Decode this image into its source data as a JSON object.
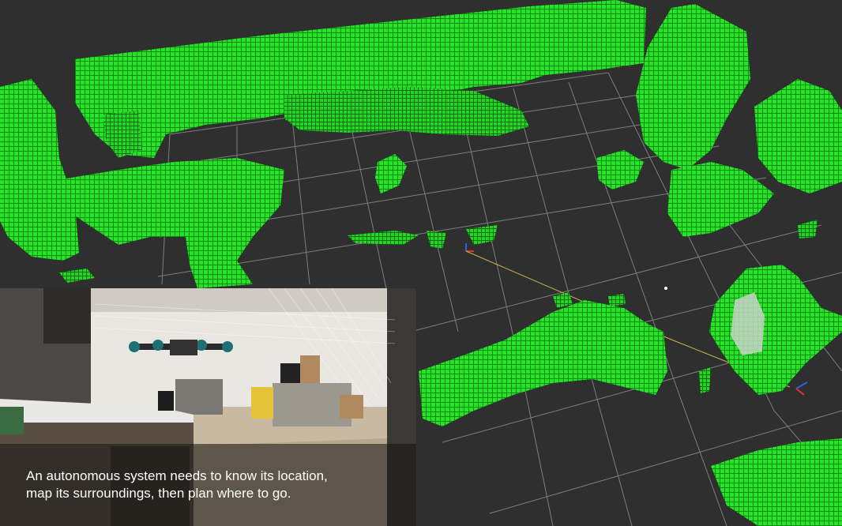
{
  "scene": {
    "background_color": "#2f2f30",
    "grid_color": "#8a8a8a",
    "voxel_color": "#22dd22",
    "voxel_shadow_color": "#0f7a0f"
  },
  "inset_video": {
    "caption_lines": [
      "An autonomous system needs to know its location,",
      "map its surroundings, then plan where to go."
    ]
  }
}
